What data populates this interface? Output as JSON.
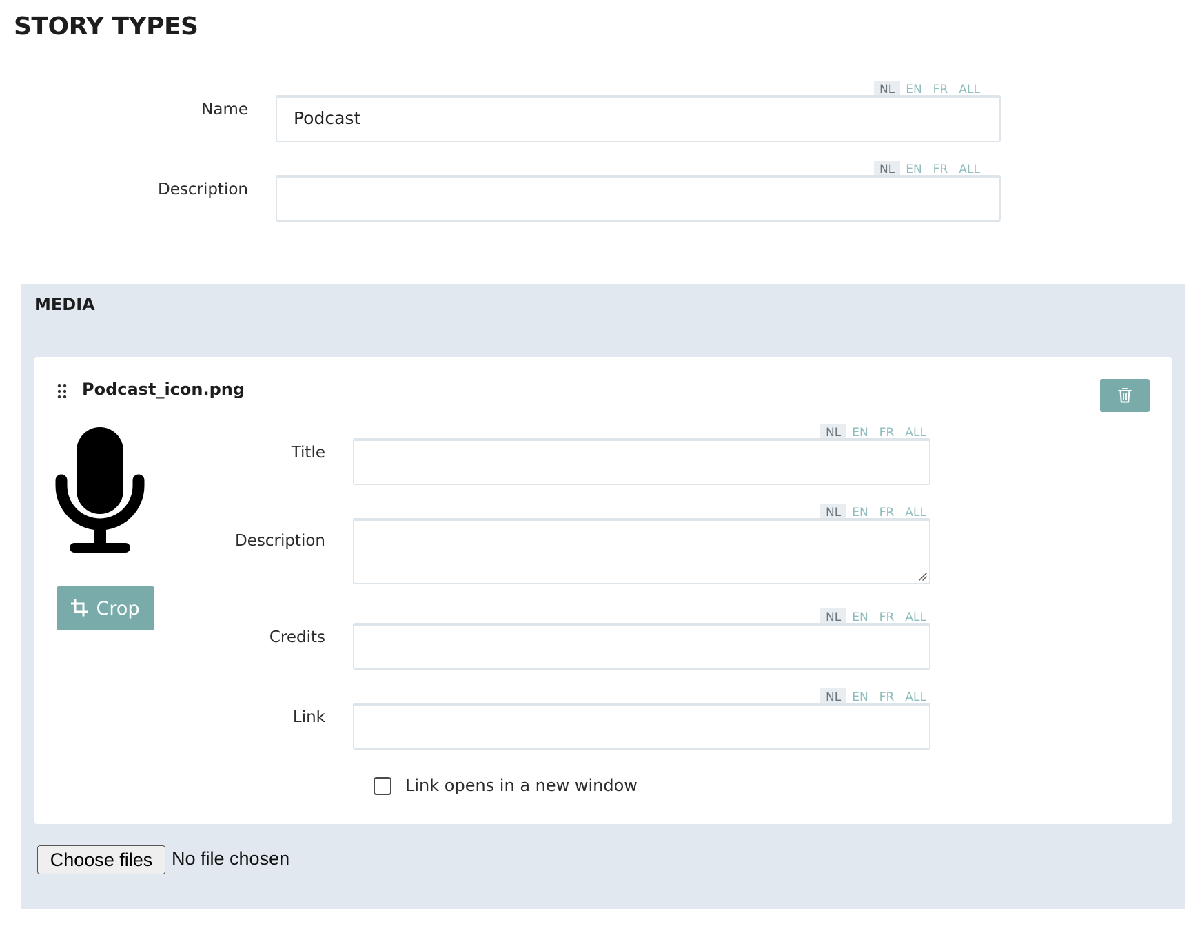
{
  "page": {
    "title": "STORY TYPES"
  },
  "languages": [
    "NL",
    "EN",
    "FR",
    "ALL"
  ],
  "active_language": "NL",
  "name_field": {
    "label": "Name",
    "value": "Podcast"
  },
  "description_field": {
    "label": "Description",
    "value": ""
  },
  "media": {
    "title": "MEDIA",
    "item": {
      "file_name": "Podcast_icon.png",
      "crop_label": "Crop",
      "title_field": {
        "label": "Title",
        "value": ""
      },
      "description_field": {
        "label": "Description",
        "value": ""
      },
      "credits_field": {
        "label": "Credits",
        "value": ""
      },
      "link_field": {
        "label": "Link",
        "value": ""
      },
      "new_window_checkbox": {
        "label": "Link opens in a new window",
        "checked": false
      }
    },
    "file_input": {
      "button_label": "Choose files",
      "status": "No file chosen"
    }
  },
  "colors": {
    "accent": "#7aabab",
    "panel_background": "#e1e8ef",
    "field_border": "#dde4ea",
    "lang_inactive": "#8fbcbc",
    "lang_active_bg": "#e8edf1"
  }
}
